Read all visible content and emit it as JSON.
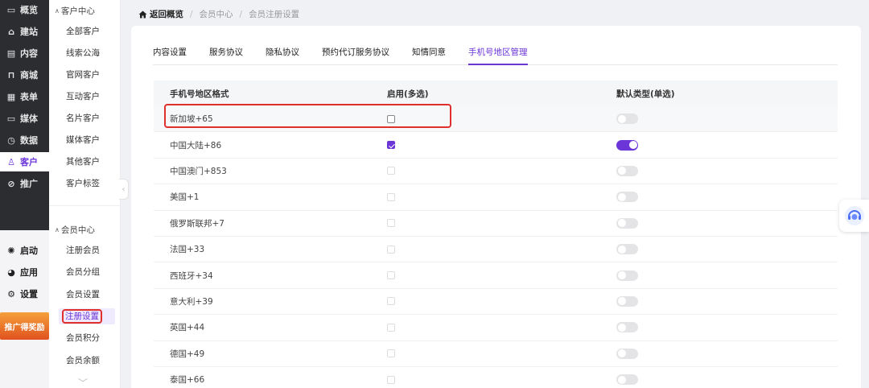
{
  "rail": {
    "items": [
      {
        "label": "概览",
        "icon": "monitor-icon"
      },
      {
        "label": "建站",
        "icon": "home-icon"
      },
      {
        "label": "内容",
        "icon": "document-icon"
      },
      {
        "label": "商城",
        "icon": "cart-icon"
      },
      {
        "label": "表单",
        "icon": "form-icon"
      },
      {
        "label": "媒体",
        "icon": "media-icon"
      },
      {
        "label": "数据",
        "icon": "clock-icon"
      },
      {
        "label": "客户",
        "icon": "user-icon",
        "active": true
      },
      {
        "label": "推广",
        "icon": "link-icon"
      }
    ],
    "bottom_items": [
      {
        "label": "启动",
        "icon": "launch-icon"
      },
      {
        "label": "应用",
        "icon": "apps-icon"
      },
      {
        "label": "设置",
        "icon": "gear-icon"
      }
    ],
    "promo_label": "推广得奖励"
  },
  "subside": {
    "customer_center": {
      "title": "客户中心",
      "items": [
        "全部客户",
        "线索公海",
        "官网客户",
        "互动客户",
        "名片客户",
        "媒体客户",
        "其他客户",
        "客户标签"
      ]
    },
    "member_center": {
      "title": "会员中心",
      "items": [
        "注册会员",
        "会员分组",
        "会员设置",
        "注册设置",
        "会员积分",
        "会员余额"
      ],
      "active": "注册设置"
    }
  },
  "breadcrumb": {
    "back": "返回概览",
    "level1": "会员中心",
    "level2": "会员注册设置"
  },
  "tabs": [
    "内容设置",
    "服务协议",
    "隐私协议",
    "预约代订服务协议",
    "知情同意",
    "手机号地区管理"
  ],
  "active_tab": "手机号地区管理",
  "table": {
    "headers": {
      "region": "手机号地区格式",
      "enabled": "启用(多选)",
      "default": "默认类型(单选)"
    },
    "rows": [
      {
        "region": "新加坡+65",
        "enabled": false,
        "enabled_editable": true,
        "default": false
      },
      {
        "region": "中国大陆+86",
        "enabled": true,
        "enabled_editable": true,
        "default": true
      },
      {
        "region": "中国澳门+853",
        "enabled": false,
        "enabled_editable": false,
        "default": false
      },
      {
        "region": "美国+1",
        "enabled": false,
        "enabled_editable": false,
        "default": false
      },
      {
        "region": "俄罗斯联邦+7",
        "enabled": false,
        "enabled_editable": false,
        "default": false
      },
      {
        "region": "法国+33",
        "enabled": false,
        "enabled_editable": false,
        "default": false
      },
      {
        "region": "西班牙+34",
        "enabled": false,
        "enabled_editable": false,
        "default": false
      },
      {
        "region": "意大利+39",
        "enabled": false,
        "enabled_editable": false,
        "default": false
      },
      {
        "region": "英国+44",
        "enabled": false,
        "enabled_editable": false,
        "default": false
      },
      {
        "region": "德国+49",
        "enabled": false,
        "enabled_editable": false,
        "default": false
      },
      {
        "region": "泰国+66",
        "enabled": false,
        "enabled_editable": false,
        "default": false
      }
    ]
  },
  "colors": {
    "accent": "#6b35d8",
    "highlight": "#e0302e",
    "rail_bg": "#2b2d31"
  }
}
